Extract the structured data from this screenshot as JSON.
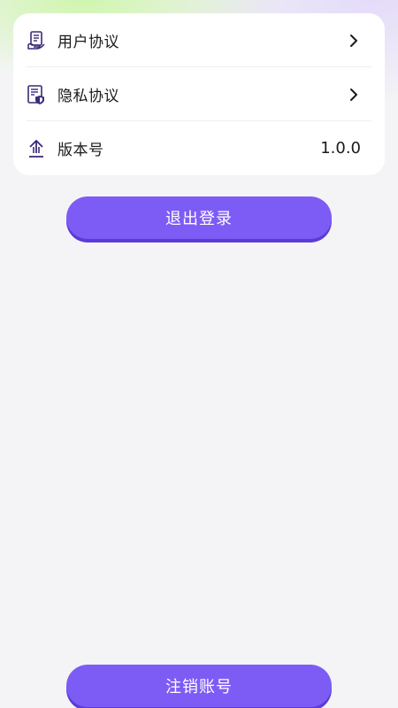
{
  "settings": {
    "items": [
      {
        "label": "用户协议",
        "icon": "user-agreement-icon",
        "trailing": "chevron-right-icon"
      },
      {
        "label": "隐私协议",
        "icon": "privacy-agreement-icon",
        "trailing": "chevron-right-icon"
      },
      {
        "label": "版本号",
        "icon": "version-upload-icon",
        "value": "1.0.0"
      }
    ]
  },
  "actions": {
    "logout_label": "退出登录",
    "delete_account_label": "注销账号"
  },
  "colors": {
    "accent": "#7d5cf5",
    "accent_shadow": "#5b3bd6",
    "icon_purple": "#3a2a7a",
    "page_bg": "#f4f4f6",
    "card_bg": "#ffffff"
  }
}
